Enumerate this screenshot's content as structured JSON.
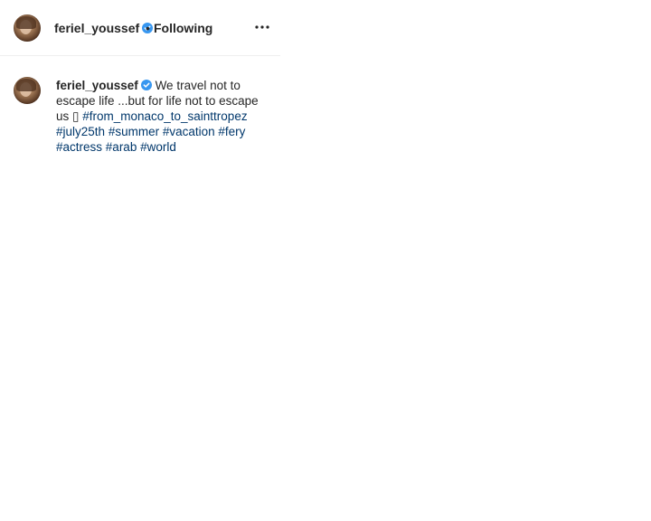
{
  "header": {
    "username": "feriel_youssef",
    "separator": "•",
    "follow_status": "Following"
  },
  "caption": {
    "username": "feriel_youssef",
    "text": "We travel not to escape life ...but for life not to escape us ▯",
    "hashtags": [
      "#from_monaco_to_sainttropez",
      "#july25th",
      "#summer",
      "#vacation",
      "#fery",
      "#actress",
      "#arab",
      "#world"
    ]
  },
  "icons": {
    "verified": "verified-badge-icon",
    "more": "more-options-icon"
  },
  "colors": {
    "verified_blue": "#3897f0",
    "hashtag": "#00376b",
    "divider": "#efefef"
  }
}
